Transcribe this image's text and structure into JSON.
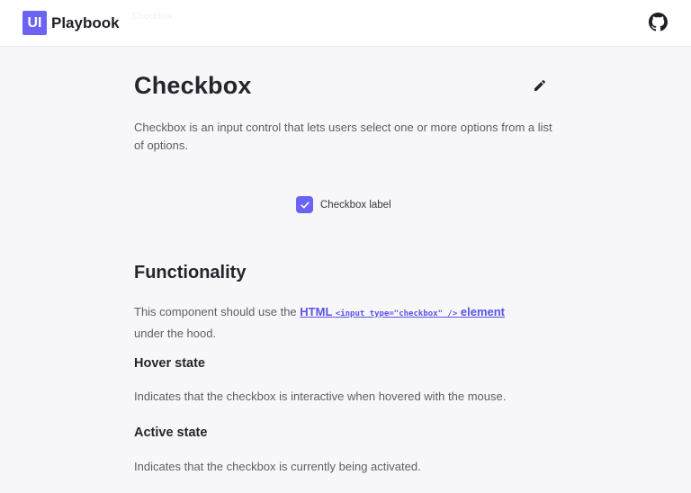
{
  "header": {
    "logo_badge": "UI",
    "logo_text": "Playbook",
    "faint_crumb": "Checkbox",
    "github_icon": "github-icon"
  },
  "page": {
    "title": "Checkbox",
    "edit_icon": "pencil-icon",
    "intro": "Checkbox is an input control that lets users select one or more options from a list of options."
  },
  "demo": {
    "checked": true,
    "label": "Checkbox label",
    "accent": "#6b63f5"
  },
  "functionality": {
    "heading": "Functionality",
    "text_before": "This component should use the ",
    "link_html": "HTML",
    "link_code": "<input type=\"checkbox\" />",
    "link_element": "element",
    "text_after": "under the hood."
  },
  "hover": {
    "heading": "Hover state",
    "text": "Indicates that the checkbox is interactive when hovered with the mouse."
  },
  "active": {
    "heading": "Active state",
    "text": "Indicates that the checkbox is currently being activated."
  }
}
